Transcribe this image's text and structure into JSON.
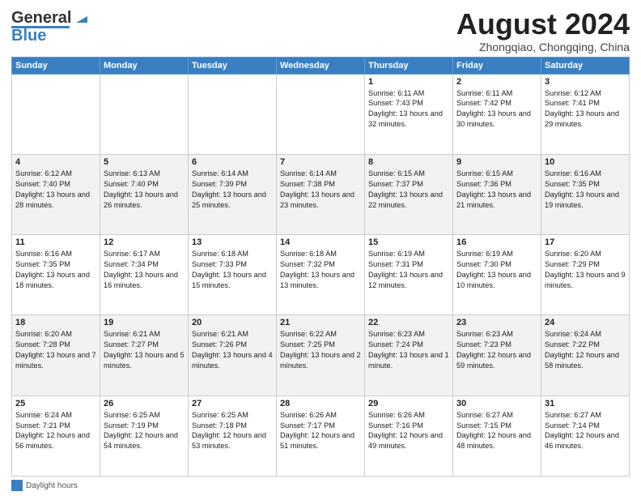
{
  "logo": {
    "line1": "General",
    "line2": "Blue"
  },
  "title": "August 2024",
  "subtitle": "Zhongqiao, Chongqing, China",
  "days": [
    "Sunday",
    "Monday",
    "Tuesday",
    "Wednesday",
    "Thursday",
    "Friday",
    "Saturday"
  ],
  "footer": {
    "legend_label": "Daylight hours"
  },
  "weeks": [
    [
      {
        "day": "",
        "sunrise": "",
        "sunset": "",
        "daylight": ""
      },
      {
        "day": "",
        "sunrise": "",
        "sunset": "",
        "daylight": ""
      },
      {
        "day": "",
        "sunrise": "",
        "sunset": "",
        "daylight": ""
      },
      {
        "day": "",
        "sunrise": "",
        "sunset": "",
        "daylight": ""
      },
      {
        "day": "1",
        "sunrise": "Sunrise: 6:11 AM",
        "sunset": "Sunset: 7:43 PM",
        "daylight": "Daylight: 13 hours and 32 minutes."
      },
      {
        "day": "2",
        "sunrise": "Sunrise: 6:11 AM",
        "sunset": "Sunset: 7:42 PM",
        "daylight": "Daylight: 13 hours and 30 minutes."
      },
      {
        "day": "3",
        "sunrise": "Sunrise: 6:12 AM",
        "sunset": "Sunset: 7:41 PM",
        "daylight": "Daylight: 13 hours and 29 minutes."
      }
    ],
    [
      {
        "day": "4",
        "sunrise": "Sunrise: 6:12 AM",
        "sunset": "Sunset: 7:40 PM",
        "daylight": "Daylight: 13 hours and 28 minutes."
      },
      {
        "day": "5",
        "sunrise": "Sunrise: 6:13 AM",
        "sunset": "Sunset: 7:40 PM",
        "daylight": "Daylight: 13 hours and 26 minutes."
      },
      {
        "day": "6",
        "sunrise": "Sunrise: 6:14 AM",
        "sunset": "Sunset: 7:39 PM",
        "daylight": "Daylight: 13 hours and 25 minutes."
      },
      {
        "day": "7",
        "sunrise": "Sunrise: 6:14 AM",
        "sunset": "Sunset: 7:38 PM",
        "daylight": "Daylight: 13 hours and 23 minutes."
      },
      {
        "day": "8",
        "sunrise": "Sunrise: 6:15 AM",
        "sunset": "Sunset: 7:37 PM",
        "daylight": "Daylight: 13 hours and 22 minutes."
      },
      {
        "day": "9",
        "sunrise": "Sunrise: 6:15 AM",
        "sunset": "Sunset: 7:36 PM",
        "daylight": "Daylight: 13 hours and 21 minutes."
      },
      {
        "day": "10",
        "sunrise": "Sunrise: 6:16 AM",
        "sunset": "Sunset: 7:35 PM",
        "daylight": "Daylight: 13 hours and 19 minutes."
      }
    ],
    [
      {
        "day": "11",
        "sunrise": "Sunrise: 6:16 AM",
        "sunset": "Sunset: 7:35 PM",
        "daylight": "Daylight: 13 hours and 18 minutes."
      },
      {
        "day": "12",
        "sunrise": "Sunrise: 6:17 AM",
        "sunset": "Sunset: 7:34 PM",
        "daylight": "Daylight: 13 hours and 16 minutes."
      },
      {
        "day": "13",
        "sunrise": "Sunrise: 6:18 AM",
        "sunset": "Sunset: 7:33 PM",
        "daylight": "Daylight: 13 hours and 15 minutes."
      },
      {
        "day": "14",
        "sunrise": "Sunrise: 6:18 AM",
        "sunset": "Sunset: 7:32 PM",
        "daylight": "Daylight: 13 hours and 13 minutes."
      },
      {
        "day": "15",
        "sunrise": "Sunrise: 6:19 AM",
        "sunset": "Sunset: 7:31 PM",
        "daylight": "Daylight: 13 hours and 12 minutes."
      },
      {
        "day": "16",
        "sunrise": "Sunrise: 6:19 AM",
        "sunset": "Sunset: 7:30 PM",
        "daylight": "Daylight: 13 hours and 10 minutes."
      },
      {
        "day": "17",
        "sunrise": "Sunrise: 6:20 AM",
        "sunset": "Sunset: 7:29 PM",
        "daylight": "Daylight: 13 hours and 9 minutes."
      }
    ],
    [
      {
        "day": "18",
        "sunrise": "Sunrise: 6:20 AM",
        "sunset": "Sunset: 7:28 PM",
        "daylight": "Daylight: 13 hours and 7 minutes."
      },
      {
        "day": "19",
        "sunrise": "Sunrise: 6:21 AM",
        "sunset": "Sunset: 7:27 PM",
        "daylight": "Daylight: 13 hours and 5 minutes."
      },
      {
        "day": "20",
        "sunrise": "Sunrise: 6:21 AM",
        "sunset": "Sunset: 7:26 PM",
        "daylight": "Daylight: 13 hours and 4 minutes."
      },
      {
        "day": "21",
        "sunrise": "Sunrise: 6:22 AM",
        "sunset": "Sunset: 7:25 PM",
        "daylight": "Daylight: 13 hours and 2 minutes."
      },
      {
        "day": "22",
        "sunrise": "Sunrise: 6:23 AM",
        "sunset": "Sunset: 7:24 PM",
        "daylight": "Daylight: 13 hours and 1 minute."
      },
      {
        "day": "23",
        "sunrise": "Sunrise: 6:23 AM",
        "sunset": "Sunset: 7:23 PM",
        "daylight": "Daylight: 12 hours and 59 minutes."
      },
      {
        "day": "24",
        "sunrise": "Sunrise: 6:24 AM",
        "sunset": "Sunset: 7:22 PM",
        "daylight": "Daylight: 12 hours and 58 minutes."
      }
    ],
    [
      {
        "day": "25",
        "sunrise": "Sunrise: 6:24 AM",
        "sunset": "Sunset: 7:21 PM",
        "daylight": "Daylight: 12 hours and 56 minutes."
      },
      {
        "day": "26",
        "sunrise": "Sunrise: 6:25 AM",
        "sunset": "Sunset: 7:19 PM",
        "daylight": "Daylight: 12 hours and 54 minutes."
      },
      {
        "day": "27",
        "sunrise": "Sunrise: 6:25 AM",
        "sunset": "Sunset: 7:18 PM",
        "daylight": "Daylight: 12 hours and 53 minutes."
      },
      {
        "day": "28",
        "sunrise": "Sunrise: 6:26 AM",
        "sunset": "Sunset: 7:17 PM",
        "daylight": "Daylight: 12 hours and 51 minutes."
      },
      {
        "day": "29",
        "sunrise": "Sunrise: 6:26 AM",
        "sunset": "Sunset: 7:16 PM",
        "daylight": "Daylight: 12 hours and 49 minutes."
      },
      {
        "day": "30",
        "sunrise": "Sunrise: 6:27 AM",
        "sunset": "Sunset: 7:15 PM",
        "daylight": "Daylight: 12 hours and 48 minutes."
      },
      {
        "day": "31",
        "sunrise": "Sunrise: 6:27 AM",
        "sunset": "Sunset: 7:14 PM",
        "daylight": "Daylight: 12 hours and 46 minutes."
      }
    ]
  ]
}
